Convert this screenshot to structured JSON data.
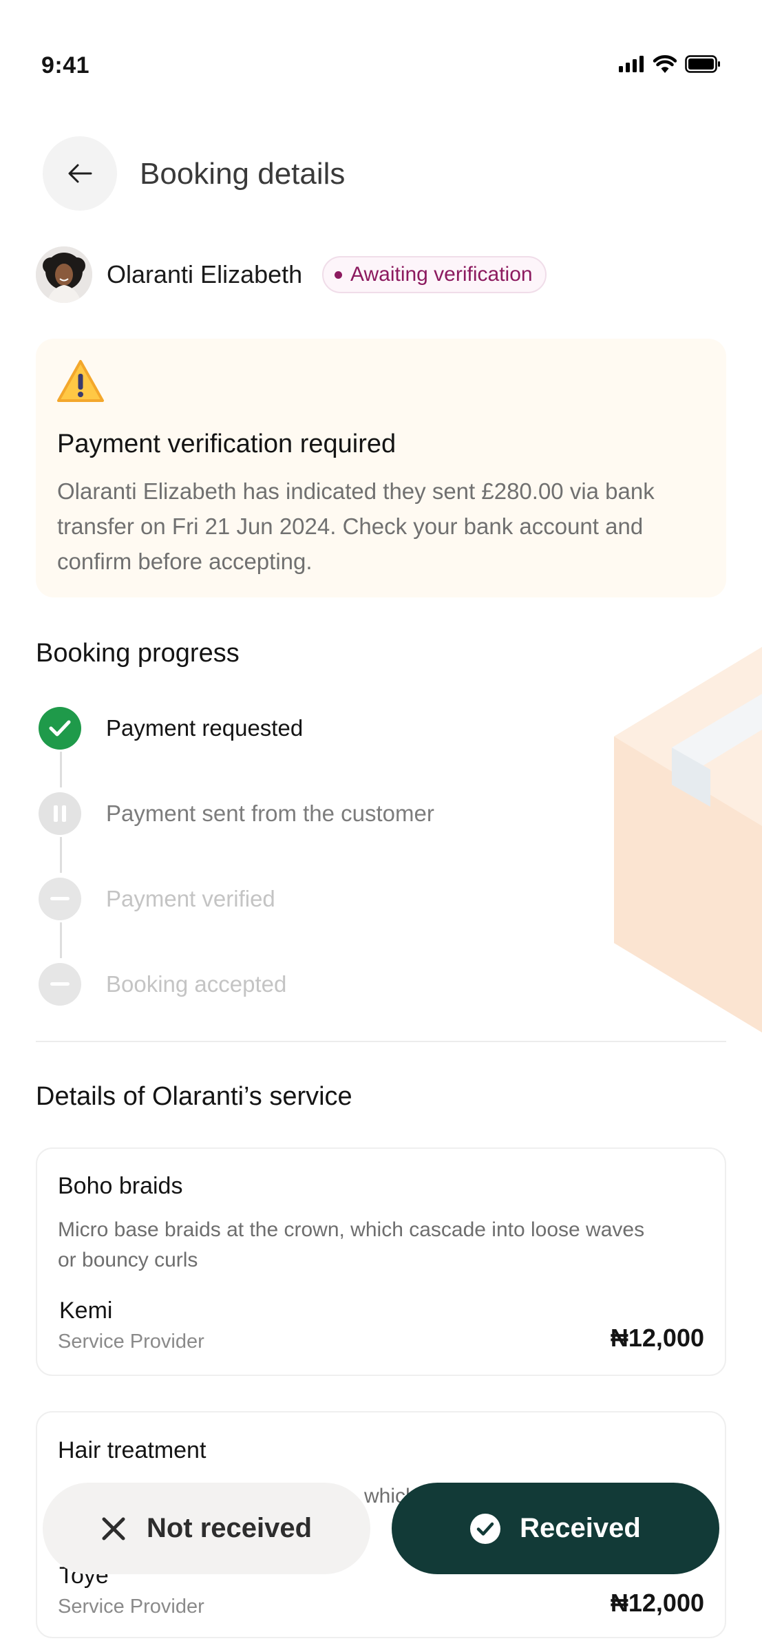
{
  "status_bar": {
    "time": "9:41"
  },
  "header": {
    "title": "Booking details"
  },
  "customer": {
    "name": "Olaranti Elizabeth",
    "status": "Awaiting verification"
  },
  "alert": {
    "title": "Payment verification required",
    "message": "Olaranti Elizabeth has indicated they sent £280.00 via bank transfer on Fri 21 Jun 2024. Check your bank account and confirm before accepting."
  },
  "progress": {
    "title": "Booking progress",
    "steps": [
      {
        "label": "Payment requested",
        "state": "done"
      },
      {
        "label": "Payment sent from the customer",
        "state": "paused"
      },
      {
        "label": "Payment verified",
        "state": "pending"
      },
      {
        "label": "Booking accepted",
        "state": "pending"
      }
    ]
  },
  "services": {
    "title": "Details of Olaranti’s service",
    "items": [
      {
        "name": "Boho braids",
        "description": "Micro base braids at the crown, which cascade into loose waves or bouncy curls",
        "provider": "Kemi",
        "role": "Service Provider",
        "price": "₦12,000"
      },
      {
        "name": "Hair treatment",
        "description": "",
        "partial_text": "which",
        "provider": "Toye",
        "role": "Service Provider",
        "price": "₦12,000"
      }
    ]
  },
  "actions": {
    "not_received": "Not received",
    "received": "Received"
  },
  "colors": {
    "primary": "#123a37",
    "success": "#1f9a4a",
    "badge_text": "#8c1a5f",
    "alert_bg": "#fffaf2"
  }
}
